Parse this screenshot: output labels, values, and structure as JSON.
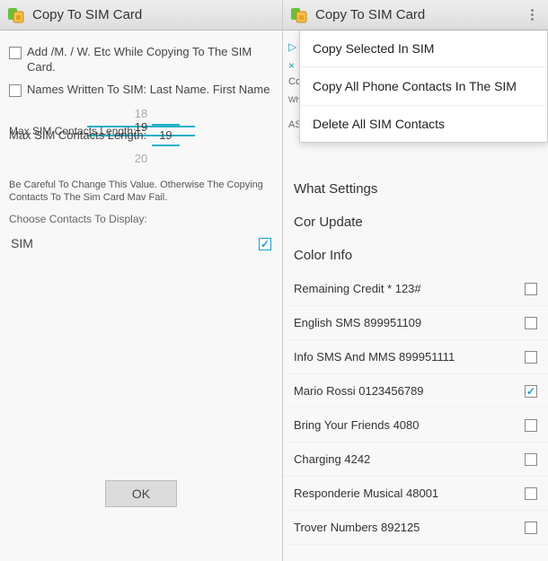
{
  "left": {
    "title": "Copy To SIM Card",
    "opt1": "Add /M. / W. Etc While Copying To The SIM Card.",
    "opt2": "Names Written To SIM: Last Name. First Name",
    "picker": {
      "above": "18",
      "label": "Max SIM Contacts Length:",
      "value": "19",
      "below": "20"
    },
    "note": "Be Careful To Change This Value. Otherwise The Copying Contacts To The Sim Card Mav Fail.",
    "choose_label": "Choose Contacts To Display:",
    "sim_label": "SIM",
    "ok": "OK"
  },
  "right": {
    "title": "Copy To SIM Card",
    "behind": {
      "b1": "▷",
      "b2": "×",
      "b3": "Co",
      "b4": "Whol",
      "b5": "ASU"
    },
    "menu": {
      "m1": "Copy Selected In SIM",
      "m2": "Copy All Phone Contacts In The SIM",
      "m3": "Delete All SIM Contacts"
    },
    "rows": {
      "r1": "What Settings",
      "r2": "Cor Update",
      "r3": "Color Info"
    },
    "contacts": [
      {
        "label": "Remaining Credit * 123#",
        "checked": false
      },
      {
        "label": "English SMS 899951109",
        "checked": false
      },
      {
        "label": "Info SMS And MMS 899951111",
        "checked": false
      },
      {
        "label": "Mario Rossi 0123456789",
        "checked": true
      },
      {
        "label": "Bring Your Friends 4080",
        "checked": false
      },
      {
        "label": "Charging 4242",
        "checked": false
      },
      {
        "label": "Responderie Musical 48001",
        "checked": false
      },
      {
        "label": "Trover Numbers 892125",
        "checked": false
      }
    ]
  }
}
